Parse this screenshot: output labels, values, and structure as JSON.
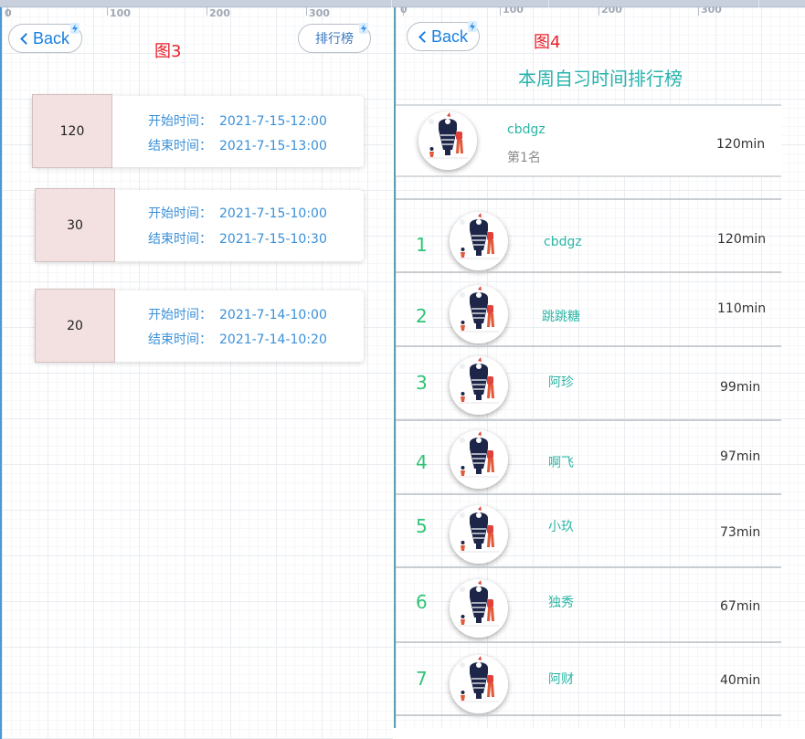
{
  "fig3": {
    "label": "图3",
    "back_label": "Back",
    "rank_button_label": "排行榜",
    "ruler": [
      "0",
      "100",
      "200",
      "300"
    ],
    "start_label": "开始时间：",
    "end_label": "结束时间：",
    "records": [
      {
        "duration": "120",
        "start": "2021-7-15-12:00",
        "end": "2021-7-15-13:00"
      },
      {
        "duration": "30",
        "start": "2021-7-15-10:00",
        "end": "2021-7-15-10:30"
      },
      {
        "duration": "20",
        "start": "2021-7-14-10:00",
        "end": "2021-7-14-10:20"
      }
    ]
  },
  "fig4": {
    "label": "图4",
    "back_label": "Back",
    "ruler": [
      "0",
      "100",
      "200",
      "300"
    ],
    "title": "本周自习时间排行榜",
    "top": {
      "name": "cbdgz",
      "place": "第1名",
      "minutes": "120min"
    },
    "rows": [
      {
        "rank": "1",
        "name": "cbdgz",
        "minutes": "120min"
      },
      {
        "rank": "2",
        "name": "跳跳糖",
        "minutes": "110min"
      },
      {
        "rank": "3",
        "name": "阿珍",
        "minutes": "99min"
      },
      {
        "rank": "4",
        "name": "啊飞",
        "minutes": "97min"
      },
      {
        "rank": "5",
        "name": "小玖",
        "minutes": "73min"
      },
      {
        "rank": "6",
        "name": "独秀",
        "minutes": "67min"
      },
      {
        "rank": "7",
        "name": "阿财",
        "minutes": "40min"
      }
    ]
  },
  "colors": {
    "accent_teal": "#27b3ad",
    "rank_green": "#2fc477",
    "link_blue": "#1a7fe0",
    "figure_label_red": "#e8202a",
    "duration_box_pink": "#f3e1e1"
  },
  "icons": {
    "back": "chevron-left-icon",
    "avatar": "avatar-illustration-icon",
    "lightning": "lightning-icon"
  }
}
